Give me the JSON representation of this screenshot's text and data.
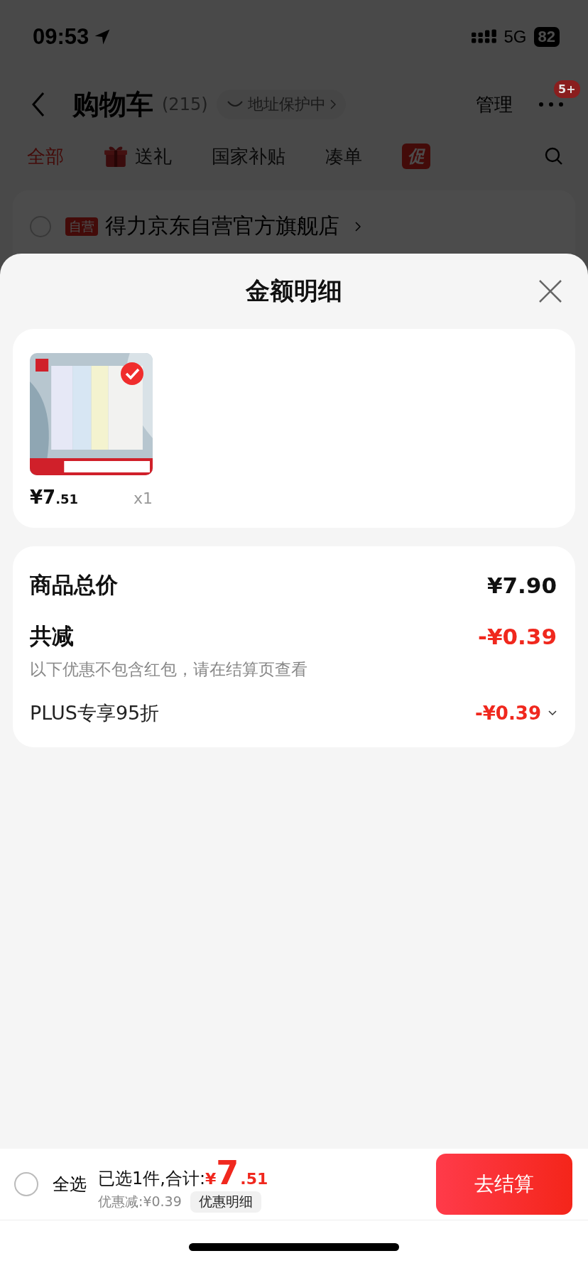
{
  "status_bar": {
    "time": "09:53",
    "network": "5G",
    "battery": "82"
  },
  "header": {
    "title": "购物车",
    "count": "(215)",
    "address_badge": "地址保护中",
    "manage": "管理",
    "more_badge": "5+"
  },
  "tabs": [
    {
      "label": "全部",
      "selected": true,
      "kind": "text"
    },
    {
      "label": "送礼",
      "selected": false,
      "kind": "gift"
    },
    {
      "label": "国家补贴",
      "selected": false,
      "kind": "text"
    },
    {
      "label": "凑单",
      "selected": false,
      "kind": "text"
    },
    {
      "label": "促",
      "selected": false,
      "kind": "promo"
    }
  ],
  "store": {
    "checked": false,
    "tag": "自营",
    "name": "得力京东自营官方旗舰店"
  },
  "sheet": {
    "title": "金额明细",
    "items": [
      {
        "kind": "picture",
        "checked": true,
        "price_main": "¥7",
        "price_decimal": ".51",
        "quantity": "x1"
      }
    ],
    "summary": {
      "total_label": "商品总价",
      "total_value": "¥7.90",
      "reduce_label": "共减",
      "reduce_value": "-¥0.39",
      "note": "以下优惠不包含红包，请在结算页查看",
      "discounts": [
        {
          "label": "PLUS专享95折",
          "value": "-¥0.39",
          "expanded": false
        }
      ]
    }
  },
  "footer": {
    "select_all": {
      "label": "全选",
      "checked": false
    },
    "selected_text": "已选1件,合计:",
    "currency": "¥",
    "total_main": "7",
    "total_decimal": ".51",
    "saving": "优惠减:¥0.39",
    "detail_button": "优惠明细",
    "checkout": "去结算"
  }
}
